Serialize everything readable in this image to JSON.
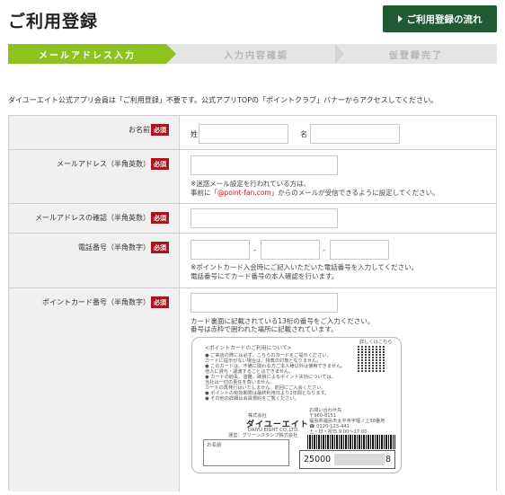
{
  "header": {
    "title": "ご利用登録",
    "flow_button": "ご利用登録の流れ"
  },
  "steps": [
    "メールアドレス入力",
    "入力内容確認",
    "仮登録完了"
  ],
  "intro": "ダイユーエイト公式アプリ会員は「ご利用登録」不要です。公式アプリTOPの「ポイントクラブ」バナーからアクセスしてください。",
  "required_badge": "必須",
  "fields": {
    "name": {
      "label": "お名前",
      "sei": "姓",
      "mei": "名"
    },
    "email": {
      "label": "メールアドレス（半角英数）",
      "note1": "※迷惑メール設定を行われている方は、",
      "note2a": "事前に「",
      "note2b": "@point-fan.com",
      "note2c": "」からのメールが受信できるように設定してください。"
    },
    "email_confirm": {
      "label": "メールアドレスの確認（半角英数）"
    },
    "phone": {
      "label": "電話番号（半角数字）",
      "dash": "-",
      "note1": "※ポイントカード入会時にご記入いただいた電話番号を入力してください。",
      "note2": "電話番号にてカード番号の本人確認を行います。"
    },
    "card": {
      "label": "ポイントカード番号（半角数字）",
      "note1": "カード裏面に記載されている13桁の番号をご入力ください。",
      "note2": "番号は赤枠で囲われた場所に記載されています。"
    }
  },
  "card_image": {
    "heading": "<ポイントカードのご利用について>",
    "lines": [
      "● ご来店の際には必ず、こちらのカードをご提示ください。",
      "  カードに提示がない場合は、特典の対象となりません。",
      "● このカードは、不備に関わる方ご本人様以外は使用できません。",
      "  他人に貸与・譲渡することはできません。",
      "● カードの紛失、盗難、破損によるポイント失効については、",
      "  当社は一切の責任を負いません。",
      "  カードの再発行はいたしません。前回にご入会ください。",
      "● ポイントの有効期限は最終利用日より2年間となります。",
      "● その他の詳細は会員規約をご覧ください。"
    ],
    "qr_label": "詳しくはこちら",
    "company_prefix": "株式会社",
    "company": "ダイユーエイト",
    "company_en": "DAIYU EIGHT CO.,LTD.",
    "issuer": "運営：グリーンスタンプ株式会社",
    "contact_title": "お問い合わせ先",
    "postal": "〒960-8151",
    "address": "福島県福島市太平寺字堰ノ上58番地",
    "tel": "☎ 0120-123-441",
    "hours": "土・日・祝日 9:00〜17:00",
    "name_label": "お名前",
    "number_prefix": "25000",
    "number_suffix": "8"
  }
}
